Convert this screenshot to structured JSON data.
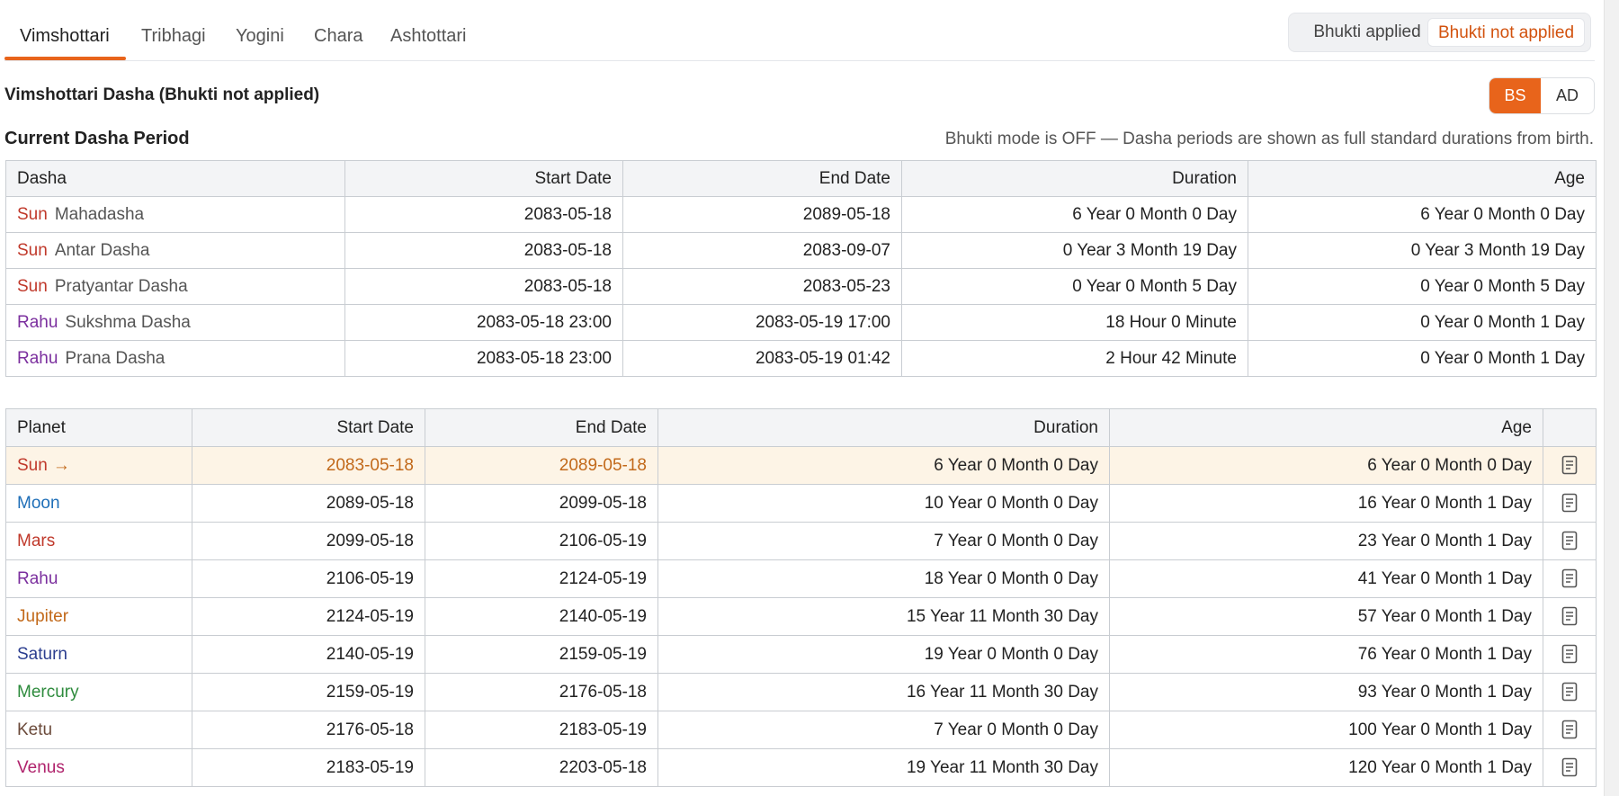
{
  "tabs": [
    "Vimshottari",
    "Tribhagi",
    "Yogini",
    "Chara",
    "Ashtottari"
  ],
  "bhukti_toggle": {
    "applied": "Bhukti applied",
    "not_applied": "Bhukti not applied"
  },
  "title": "Vimshottari Dasha (Bhukti not applied)",
  "calendar_toggle": {
    "bs": "BS",
    "ad": "AD"
  },
  "current_period": {
    "heading": "Current Dasha Period",
    "note": "Bhukti mode is OFF — Dasha periods are shown as full standard durations from birth.",
    "headers": [
      "Dasha",
      "Start Date",
      "End Date",
      "Duration",
      "Age"
    ],
    "rows": [
      {
        "planet": "Sun",
        "level": "Mahadasha",
        "start": "2083-05-18",
        "end": "2089-05-18",
        "duration": "6 Year 0 Month 0 Day",
        "age": "6 Year 0 Month 0 Day"
      },
      {
        "planet": "Sun",
        "level": "Antar Dasha",
        "start": "2083-05-18",
        "end": "2083-09-07",
        "duration": "0 Year 3 Month 19 Day",
        "age": "0 Year 3 Month 19 Day"
      },
      {
        "planet": "Sun",
        "level": "Pratyantar Dasha",
        "start": "2083-05-18",
        "end": "2083-05-23",
        "duration": "0 Year 0 Month 5 Day",
        "age": "0 Year 0 Month 5 Day"
      },
      {
        "planet": "Rahu",
        "level": "Sukshma Dasha",
        "start": "2083-05-18 23:00",
        "end": "2083-05-19 17:00",
        "duration": "18 Hour 0 Minute",
        "age": "0 Year 0 Month 1 Day"
      },
      {
        "planet": "Rahu",
        "level": "Prana Dasha",
        "start": "2083-05-18 23:00",
        "end": "2083-05-19 01:42",
        "duration": "2 Hour 42 Minute",
        "age": "0 Year 0 Month 1 Day"
      }
    ]
  },
  "dasha_table": {
    "headers": [
      "Planet",
      "Start Date",
      "End Date",
      "Duration",
      "Age"
    ],
    "current_arrow": "→",
    "rows": [
      {
        "planet": "Sun",
        "start": "2083-05-18",
        "end": "2089-05-18",
        "duration": "6 Year 0 Month 0 Day",
        "age": "6 Year 0 Month 0 Day"
      },
      {
        "planet": "Moon",
        "start": "2089-05-18",
        "end": "2099-05-18",
        "duration": "10 Year 0 Month 0 Day",
        "age": "16 Year 0 Month 1 Day"
      },
      {
        "planet": "Mars",
        "start": "2099-05-18",
        "end": "2106-05-19",
        "duration": "7 Year 0 Month 0 Day",
        "age": "23 Year 0 Month 1 Day"
      },
      {
        "planet": "Rahu",
        "start": "2106-05-19",
        "end": "2124-05-19",
        "duration": "18 Year 0 Month 0 Day",
        "age": "41 Year 0 Month 1 Day"
      },
      {
        "planet": "Jupiter",
        "start": "2124-05-19",
        "end": "2140-05-19",
        "duration": "15 Year 11 Month 30 Day",
        "age": "57 Year 0 Month 1 Day"
      },
      {
        "planet": "Saturn",
        "start": "2140-05-19",
        "end": "2159-05-19",
        "duration": "19 Year 0 Month 0 Day",
        "age": "76 Year 0 Month 1 Day"
      },
      {
        "planet": "Mercury",
        "start": "2159-05-19",
        "end": "2176-05-18",
        "duration": "16 Year 11 Month 30 Day",
        "age": "93 Year 0 Month 1 Day"
      },
      {
        "planet": "Ketu",
        "start": "2176-05-18",
        "end": "2183-05-19",
        "duration": "7 Year 0 Month 0 Day",
        "age": "100 Year 0 Month 1 Day"
      },
      {
        "planet": "Venus",
        "start": "2183-05-19",
        "end": "2203-05-18",
        "duration": "19 Year 11 Month 30 Day",
        "age": "120 Year 0 Month 1 Day"
      }
    ]
  },
  "colors": {
    "accent": "#e8641b",
    "current_row_bg": "#fdf4e6"
  }
}
